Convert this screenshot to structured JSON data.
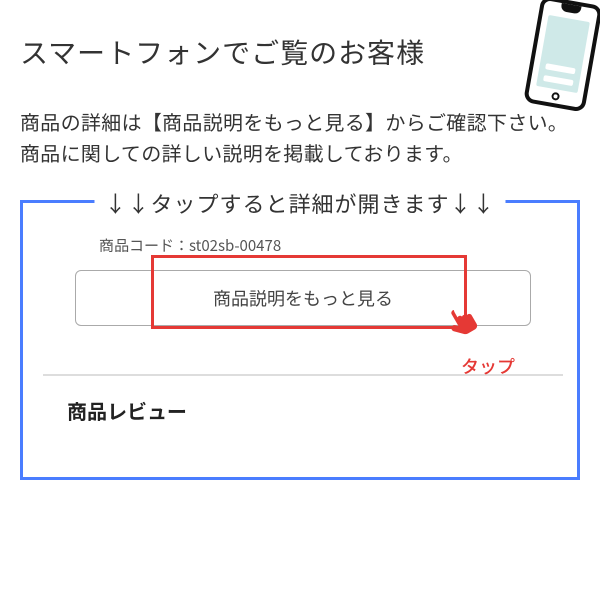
{
  "heading": "スマートフォンでご覧のお客様",
  "body_line1": "商品の詳細は【商品説明をもっと見る】からご確認下さい。",
  "body_line2": "商品に関しての詳しい説明を掲載しております。",
  "blue_box_label": "↓↓タップすると詳細が開きます↓↓",
  "product_code_label": "商品コード：",
  "product_code_value": "st02sb-00478",
  "more_button_label": "商品説明をもっと見る",
  "review_heading": "商品レビュー",
  "tap_label": "タップ"
}
